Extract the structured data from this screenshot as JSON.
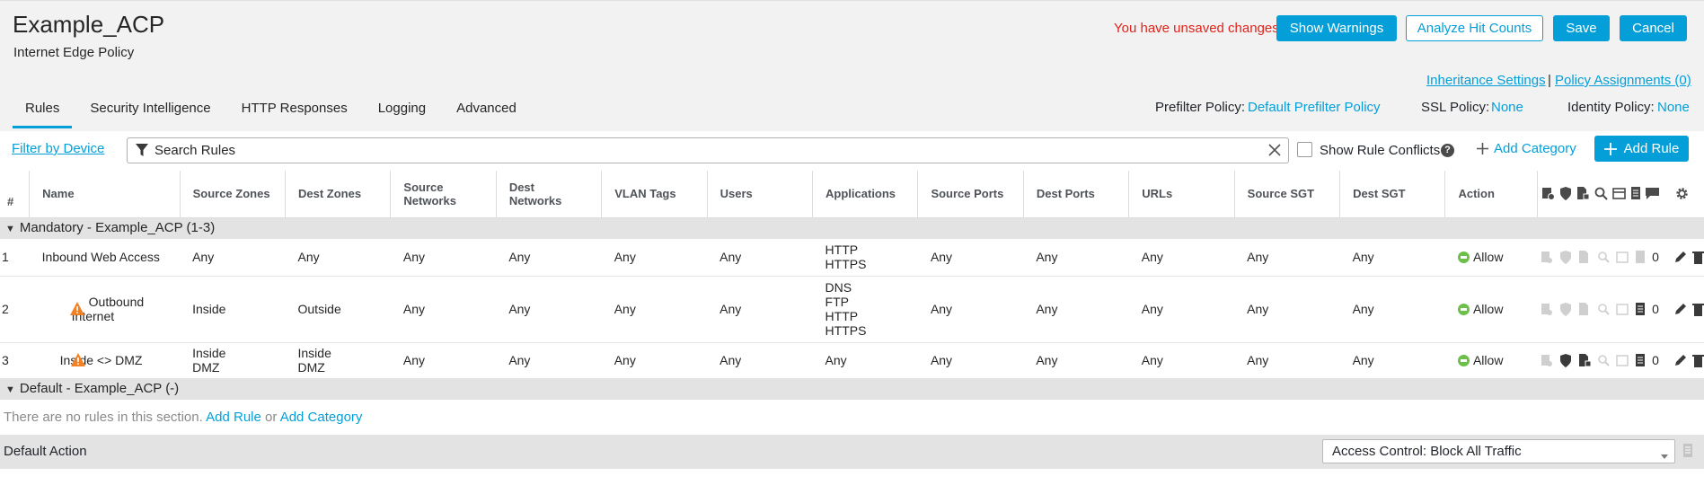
{
  "header": {
    "title": "Example_ACP",
    "subtitle": "Internet Edge Policy",
    "unsaved_message": "You have unsaved changes",
    "show_warnings_label": "Show Warnings",
    "analyze_hit_counts_label": "Analyze Hit Counts",
    "save_label": "Save",
    "cancel_label": "Cancel",
    "inheritance_settings": "Inheritance Settings",
    "separator": "|",
    "policy_assignments": "Policy Assignments (0)"
  },
  "tabs": [
    {
      "label": "Rules",
      "active": true
    },
    {
      "label": "Security Intelligence"
    },
    {
      "label": "HTTP Responses"
    },
    {
      "label": "Logging"
    },
    {
      "label": "Advanced"
    }
  ],
  "policies": {
    "prefilter_label": "Prefilter Policy:",
    "prefilter_value": "Default Prefilter Policy",
    "ssl_label": "SSL Policy:",
    "ssl_value": "None",
    "identity_label": "Identity Policy:",
    "identity_value": "None"
  },
  "toolbar": {
    "filter_by_device": "Filter by Device",
    "search_placeholder": "Search Rules",
    "show_rule_conflicts": "Show Rule Conflicts",
    "add_category": "Add Category",
    "add_rule": "Add Rule"
  },
  "table": {
    "columns": [
      "#",
      "Name",
      "Source Zones",
      "Dest Zones",
      "Source Networks",
      "Dest Networks",
      "VLAN Tags",
      "Users",
      "Applications",
      "Source Ports",
      "Dest Ports",
      "URLs",
      "Source SGT",
      "Dest SGT",
      "Action"
    ],
    "icon_columns": [
      "intrusion-policy-icon",
      "shield-icon",
      "file-policy-icon",
      "logging-icon",
      "log-destination-icon",
      "comment-icon",
      "gear-icon"
    ],
    "sections": [
      {
        "title": "Mandatory - Example_ACP (1-3)",
        "rules": [
          {
            "num": "1",
            "name": "Inbound Web Access",
            "warning": false,
            "source_zones": [
              "Any"
            ],
            "dest_zones": [
              "Any"
            ],
            "source_networks": "Any",
            "dest_networks": "Any",
            "vlan_tags": "Any",
            "users": "Any",
            "applications": [
              "HTTP",
              "HTTPS"
            ],
            "source_ports": "Any",
            "dest_ports": "Any",
            "urls": "Any",
            "source_sgt": "Any",
            "dest_sgt": "Any",
            "action": "Allow",
            "hit_count": "0"
          },
          {
            "num": "2",
            "name": "Outbound Internet",
            "warning": true,
            "source_zones": [
              "Inside"
            ],
            "dest_zones": [
              "Outside"
            ],
            "source_networks": "Any",
            "dest_networks": "Any",
            "vlan_tags": "Any",
            "users": "Any",
            "applications": [
              "DNS",
              "FTP",
              "HTTP",
              "HTTPS"
            ],
            "source_ports": "Any",
            "dest_ports": "Any",
            "urls": "Any",
            "source_sgt": "Any",
            "dest_sgt": "Any",
            "action": "Allow",
            "hit_count": "0"
          },
          {
            "num": "3",
            "name": "Inside <> DMZ",
            "warning": true,
            "source_zones": [
              "Inside",
              "DMZ"
            ],
            "dest_zones": [
              "Inside",
              "DMZ"
            ],
            "source_networks": "Any",
            "dest_networks": "Any",
            "vlan_tags": "Any",
            "users": "Any",
            "applications": [
              "Any"
            ],
            "source_ports": "Any",
            "dest_ports": "Any",
            "urls": "Any",
            "source_sgt": "Any",
            "dest_sgt": "Any",
            "action": "Allow",
            "hit_count": "0"
          }
        ]
      },
      {
        "title": "Default - Example_ACP (-)",
        "rules": []
      }
    ]
  },
  "empty_section": {
    "text": "There are no rules in this section.",
    "add_rule": "Add Rule",
    "or": "or",
    "add_category": "Add Category"
  },
  "default_action": {
    "label": "Default Action",
    "value": "Access Control: Block All Traffic"
  },
  "colors": {
    "accent": "#049fd9",
    "warning": "#f48024",
    "allow": "#6cc04a",
    "unsaved": "#e2231a"
  }
}
